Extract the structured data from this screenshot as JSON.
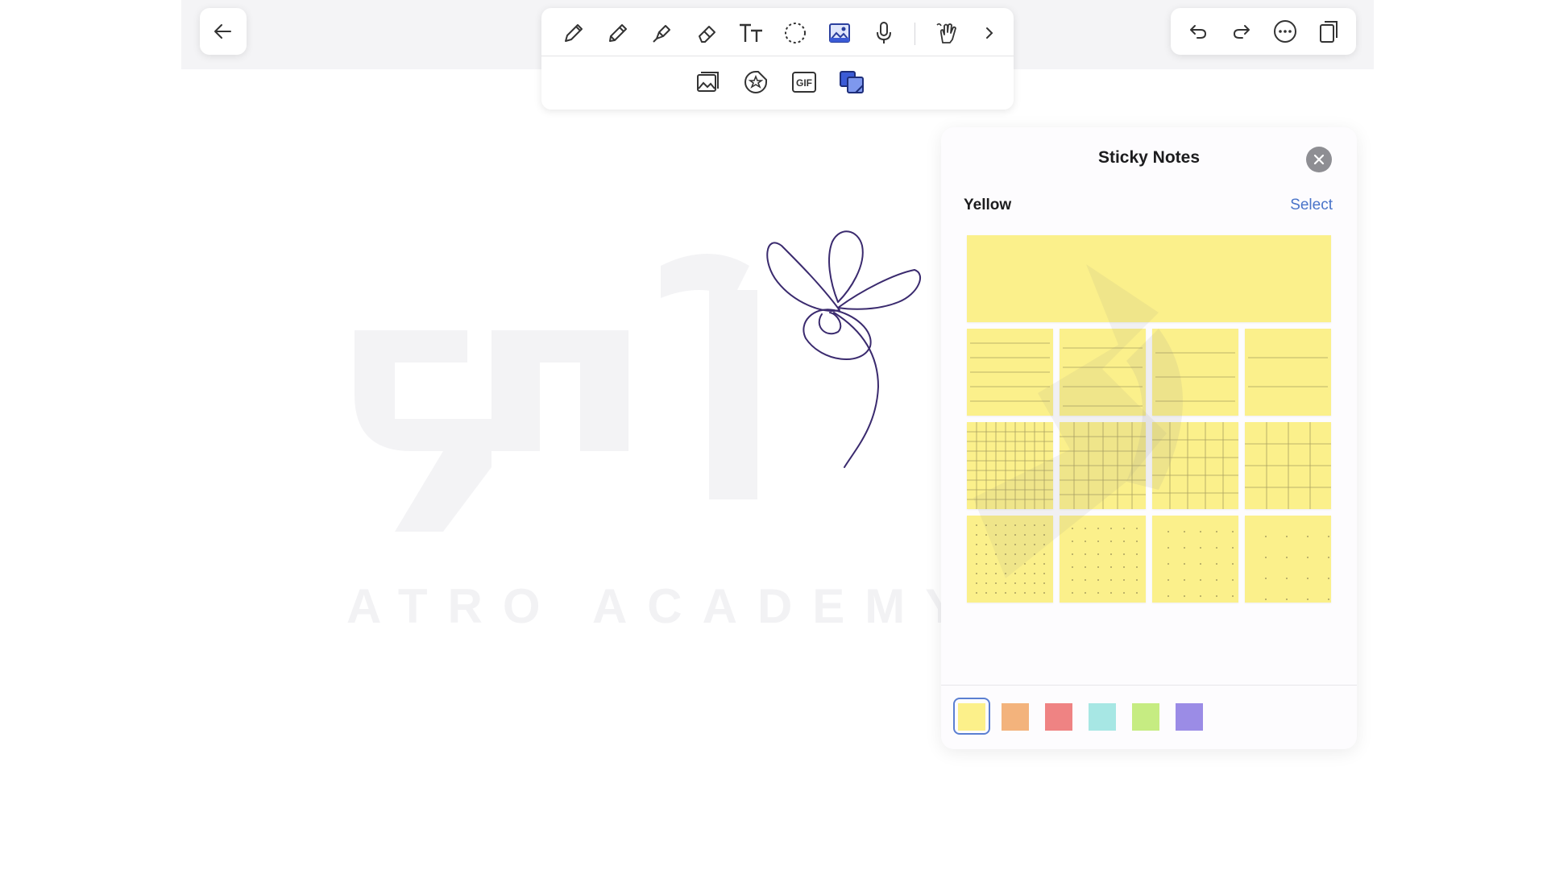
{
  "app": {
    "panel_title": "Sticky Notes",
    "color_name": "Yellow",
    "select_label": "Select",
    "watermark_text": "ATRO ACADEMY"
  },
  "toolbar": {
    "row1_icons": [
      "pen-icon",
      "pencil-icon",
      "highlighter-icon",
      "eraser-icon",
      "text-icon",
      "lasso-icon",
      "image-icon",
      "microphone-icon",
      "finger-draw-icon",
      "chevron-right-icon"
    ],
    "row2_icons": [
      "photo-library-icon",
      "sticker-icon",
      "gif-icon",
      "sticky-notes-icon"
    ],
    "gif_label": "GIF",
    "active_tool": "image-icon",
    "active_color": "#3b5bd6"
  },
  "actions": {
    "icons": [
      "undo-icon",
      "redo-icon",
      "more-icon",
      "pages-icon"
    ]
  },
  "sticky_notes": {
    "note_color": "#fbf08b",
    "rows": [
      "plain",
      "lined",
      "grid",
      "dotted"
    ],
    "notes_per_row": 4
  },
  "colors": {
    "selected": "yellow",
    "swatches": [
      {
        "name": "yellow",
        "hex": "#fcf08a"
      },
      {
        "name": "orange",
        "hex": "#f3b37c"
      },
      {
        "name": "red",
        "hex": "#ef8383"
      },
      {
        "name": "cyan",
        "hex": "#a7e7e4"
      },
      {
        "name": "green",
        "hex": "#c6ec82"
      },
      {
        "name": "purple",
        "hex": "#9b8ce6"
      }
    ]
  }
}
